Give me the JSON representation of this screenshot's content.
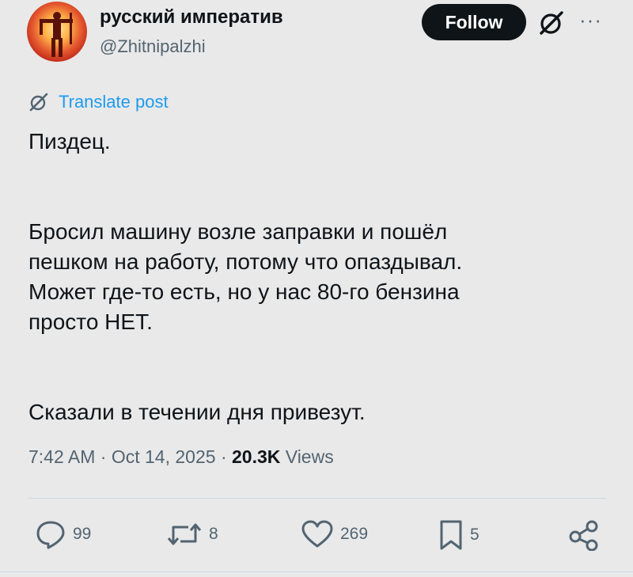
{
  "profile": {
    "display_name": "русский императив",
    "handle": "@Zhitnipalzhi",
    "follow_label": "Follow",
    "more_label": "···"
  },
  "translate": {
    "label": "Translate post"
  },
  "tweet": {
    "paragraphs": [
      [
        "Пиздец."
      ],
      [
        "Бросил машину возле заправки и пошёл",
        "пешком на работу, потому что опаздывал.",
        "Может где-то есть, но у нас 80-го бензина",
        "просто НЕТ."
      ],
      [
        "Сказали в течении дня привезут."
      ]
    ]
  },
  "meta": {
    "time": "7:42 AM",
    "sep1": "·",
    "date": "Oct 14, 2025",
    "sep2": "·",
    "views_count": "20.3K",
    "views_label": "Views"
  },
  "actions": {
    "replies": "99",
    "reposts": "8",
    "likes": "269",
    "bookmarks": "5"
  },
  "colors": {
    "background": "#e9e9e9",
    "text": "#0f1419",
    "secondary": "#536471",
    "accent": "#1d9bf0",
    "follow_bg": "#0f1419"
  },
  "icons": [
    "grok-icon",
    "more-icon",
    "translate-icon",
    "reply-icon",
    "repost-icon",
    "like-icon",
    "bookmark-icon",
    "share-icon"
  ]
}
